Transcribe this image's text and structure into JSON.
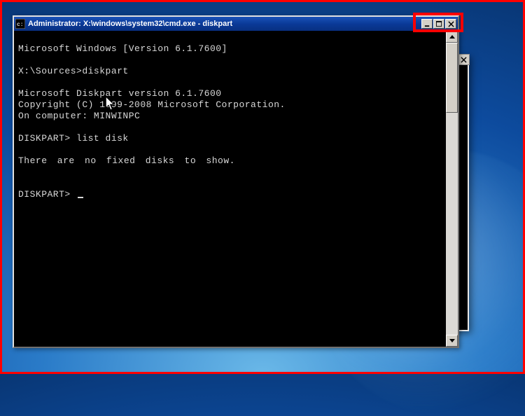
{
  "window": {
    "title": "Administrator: X:\\windows\\system32\\cmd.exe - diskpart"
  },
  "terminal": {
    "header": "Microsoft Windows [Version 6.1.7600]",
    "prompt1": "X:\\Sources>diskpart",
    "version": "Microsoft Diskpart version 6.1.7600",
    "copyright": "Copyright (C) 1999-2008 Microsoft Corporation.",
    "computer": "On computer: MINWINPC",
    "cmd1": "DISKPART> list disk",
    "result1": "There are no fixed disks to show.",
    "prompt2": "DISKPART> "
  }
}
